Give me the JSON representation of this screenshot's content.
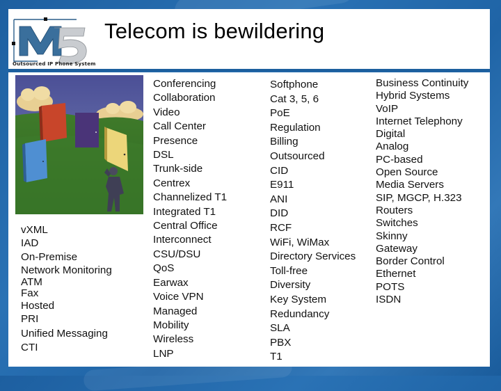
{
  "header": {
    "title": "Telecom is bewildering",
    "logo": {
      "mark": "M5",
      "tagline": "Outsourced IP Phone System",
      "colors": {
        "m": "#3a6f9c",
        "five": "#c9ccd0",
        "frame": "#2b5e8a"
      }
    }
  },
  "illustration": {
    "description": "Man standing in green field facing colored doors",
    "icon": "doors-illustration"
  },
  "columns": [
    {
      "items": [
        "vXML",
        "IAD",
        "On-Premise",
        "Network Monitoring",
        "ATM",
        "Fax",
        "Hosted",
        "PRI",
        "Unified Messaging",
        "CTI"
      ]
    },
    {
      "items": [
        "Conferencing",
        "Collaboration",
        "Video",
        "Call Center",
        "Presence",
        "DSL",
        "Trunk-side",
        "Centrex",
        "Channelized T1",
        "Integrated T1",
        "Central Office",
        "Interconnect",
        "CSU/DSU",
        "QoS",
        "Earwax",
        "Voice VPN",
        "Managed",
        "Mobility",
        "Wireless",
        "LNP"
      ]
    },
    {
      "items": [
        "Softphone",
        "Cat 3, 5, 6",
        "PoE",
        "Regulation",
        "Billing",
        "Outsourced",
        "CID",
        "E911",
        "ANI",
        "DID",
        "RCF",
        "WiFi, WiMax",
        "Directory Services",
        "Toll-free",
        "Diversity",
        "Key System",
        "Redundancy",
        "SLA",
        "PBX",
        "T1"
      ]
    },
    {
      "items": [
        "Business Continuity",
        "Hybrid Systems",
        "VoIP",
        "Internet Telephony",
        "Digital",
        "Analog",
        "PC-based",
        "Open Source",
        "Media Servers",
        "SIP, MGCP, H.323",
        "Routers",
        "Switches",
        "Skinny",
        "Gateway",
        "Border Control",
        "Ethernet",
        "POTS",
        "ISDN"
      ]
    }
  ],
  "theme": {
    "background": "#1f64a6",
    "panel": "#ffffff",
    "separator": "#1c5f9e"
  }
}
